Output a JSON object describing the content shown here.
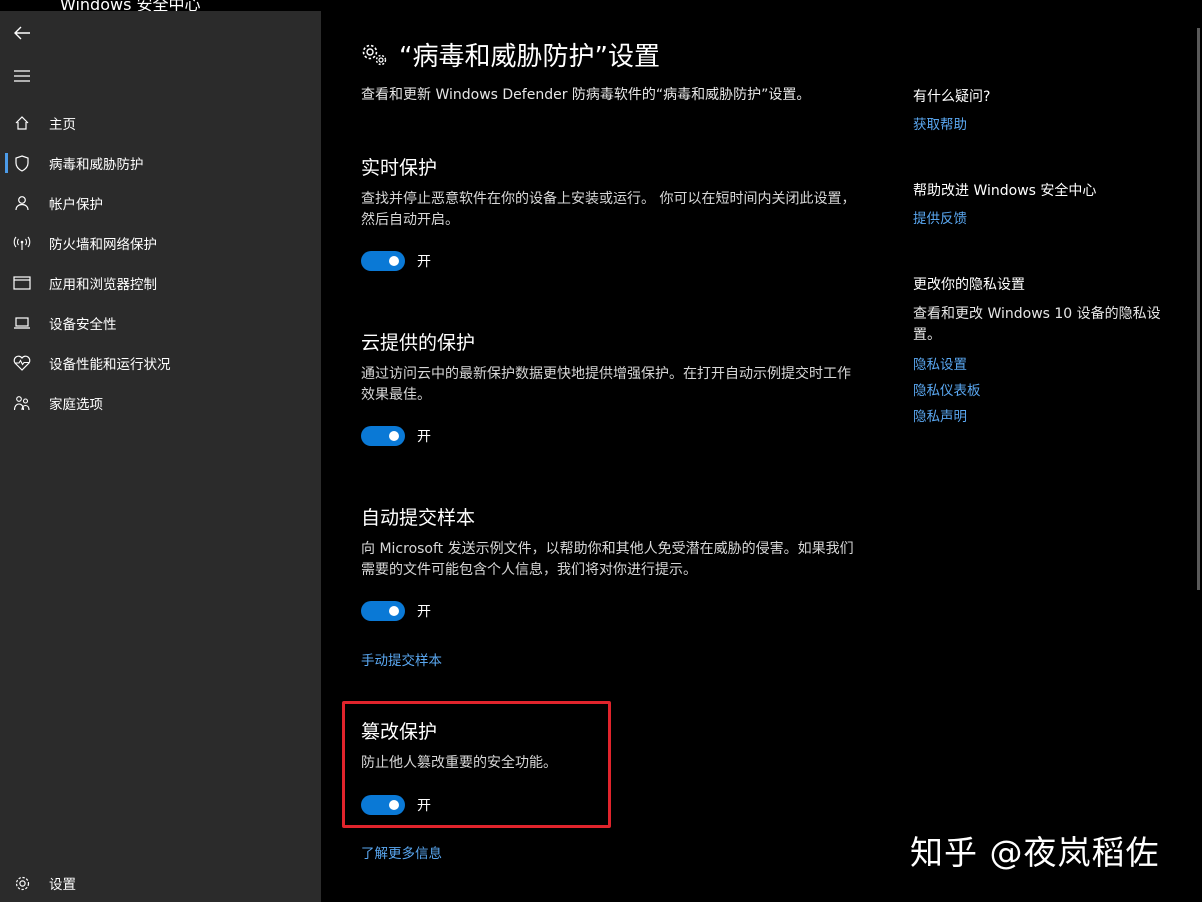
{
  "titlebar": {
    "fragment": "Windows 安全中心"
  },
  "sidebar": {
    "items": [
      {
        "label": "主页",
        "icon": "home-icon"
      },
      {
        "label": "病毒和威胁防护",
        "icon": "shield-icon",
        "active": true
      },
      {
        "label": "帐户保护",
        "icon": "person-icon"
      },
      {
        "label": "防火墙和网络保护",
        "icon": "antenna-icon"
      },
      {
        "label": "应用和浏览器控制",
        "icon": "window-icon"
      },
      {
        "label": "设备安全性",
        "icon": "laptop-icon"
      },
      {
        "label": "设备性能和运行状况",
        "icon": "heart-icon"
      },
      {
        "label": "家庭选项",
        "icon": "family-icon"
      }
    ],
    "settings_label": "设置"
  },
  "main": {
    "title": "“病毒和威胁防护”设置",
    "subtitle": "查看和更新 Windows Defender 防病毒软件的“病毒和威胁防护”设置。",
    "sections": [
      {
        "heading": "实时保护",
        "desc": "查找并停止恶意软件在你的设备上安装或运行。 你可以在短时间内关闭此设置，然后自动开启。",
        "toggle": "开"
      },
      {
        "heading": "云提供的保护",
        "desc": "通过访问云中的最新保护数据更快地提供增强保护。在打开自动示例提交时工作效果最佳。",
        "toggle": "开"
      },
      {
        "heading": "自动提交样本",
        "desc": "向 Microsoft 发送示例文件，以帮助你和其他人免受潜在威胁的侵害。如果我们需要的文件可能包含个人信息，我们将对你进行提示。",
        "toggle": "开",
        "link": "手动提交样本"
      },
      {
        "heading": "篡改保护",
        "desc": "防止他人篡改重要的安全功能。",
        "toggle": "开",
        "link": "了解更多信息"
      }
    ]
  },
  "aside": {
    "question_heading": "有什么疑问?",
    "get_help": "获取帮助",
    "improve_heading": "帮助改进 Windows 安全中心",
    "feedback": "提供反馈",
    "privacy_heading": "更改你的隐私设置",
    "privacy_text": "查看和更改 Windows 10 设备的隐私设置。",
    "privacy_settings": "隐私设置",
    "privacy_dashboard": "隐私仪表板",
    "privacy_statement": "隐私声明"
  },
  "watermark": "知乎 @夜岚稻佐",
  "colors": {
    "accent": "#0a79d6",
    "link": "#5aa7f0",
    "highlight": "#e0242c",
    "sidebar": "#2b2b2b"
  }
}
